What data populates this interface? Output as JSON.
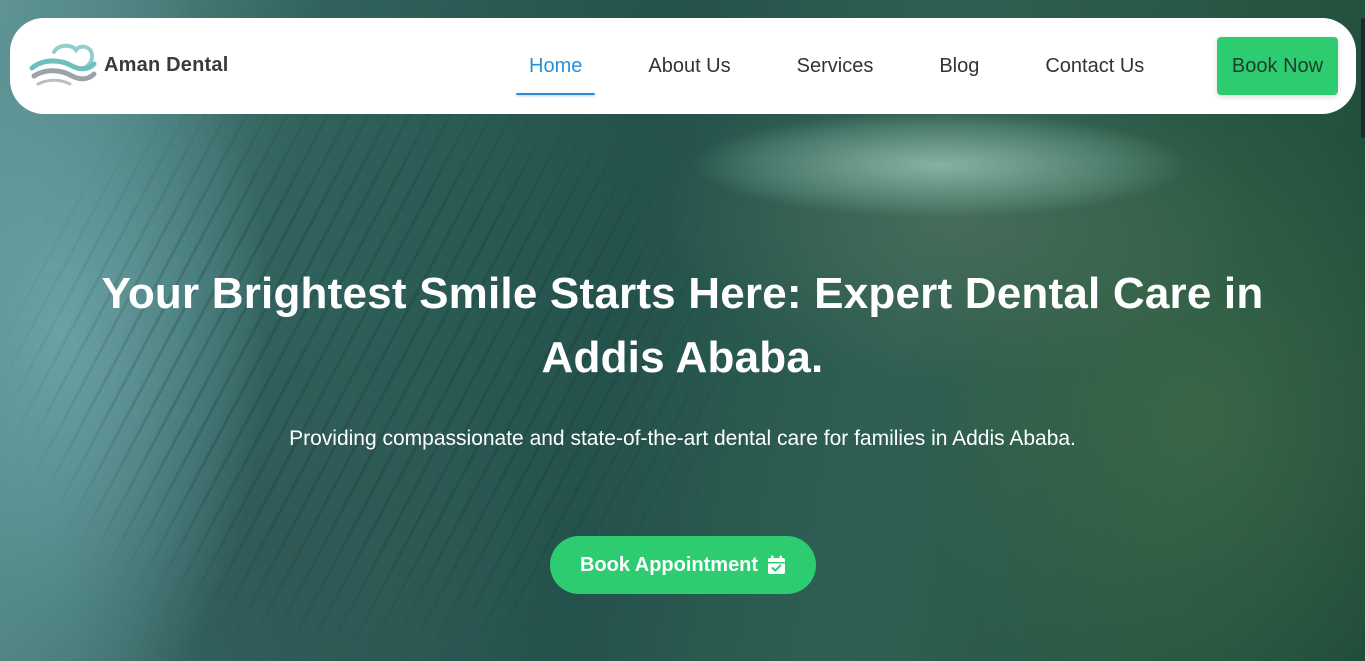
{
  "brand": {
    "name": "Aman Dental",
    "logo_icon": "tooth-wave-logo-icon"
  },
  "nav": {
    "items": [
      {
        "label": "Home",
        "active": true
      },
      {
        "label": "About Us",
        "active": false
      },
      {
        "label": "Services",
        "active": false
      },
      {
        "label": "Blog",
        "active": false
      },
      {
        "label": "Contact Us",
        "active": false
      }
    ],
    "cta_label": "Book Now"
  },
  "hero": {
    "title": "Your Brightest Smile Starts Here: Expert Dental Care in Addis Ababa.",
    "subtitle": "Providing compassionate and state-of-the-art dental care for families in Addis Ababa.",
    "cta_label": "Book Appointment",
    "cta_icon": "calendar-check-icon"
  },
  "colors": {
    "accent_green": "#2ecc71",
    "active_link_blue": "#2b8ed8",
    "navbar_bg": "#ffffff"
  }
}
